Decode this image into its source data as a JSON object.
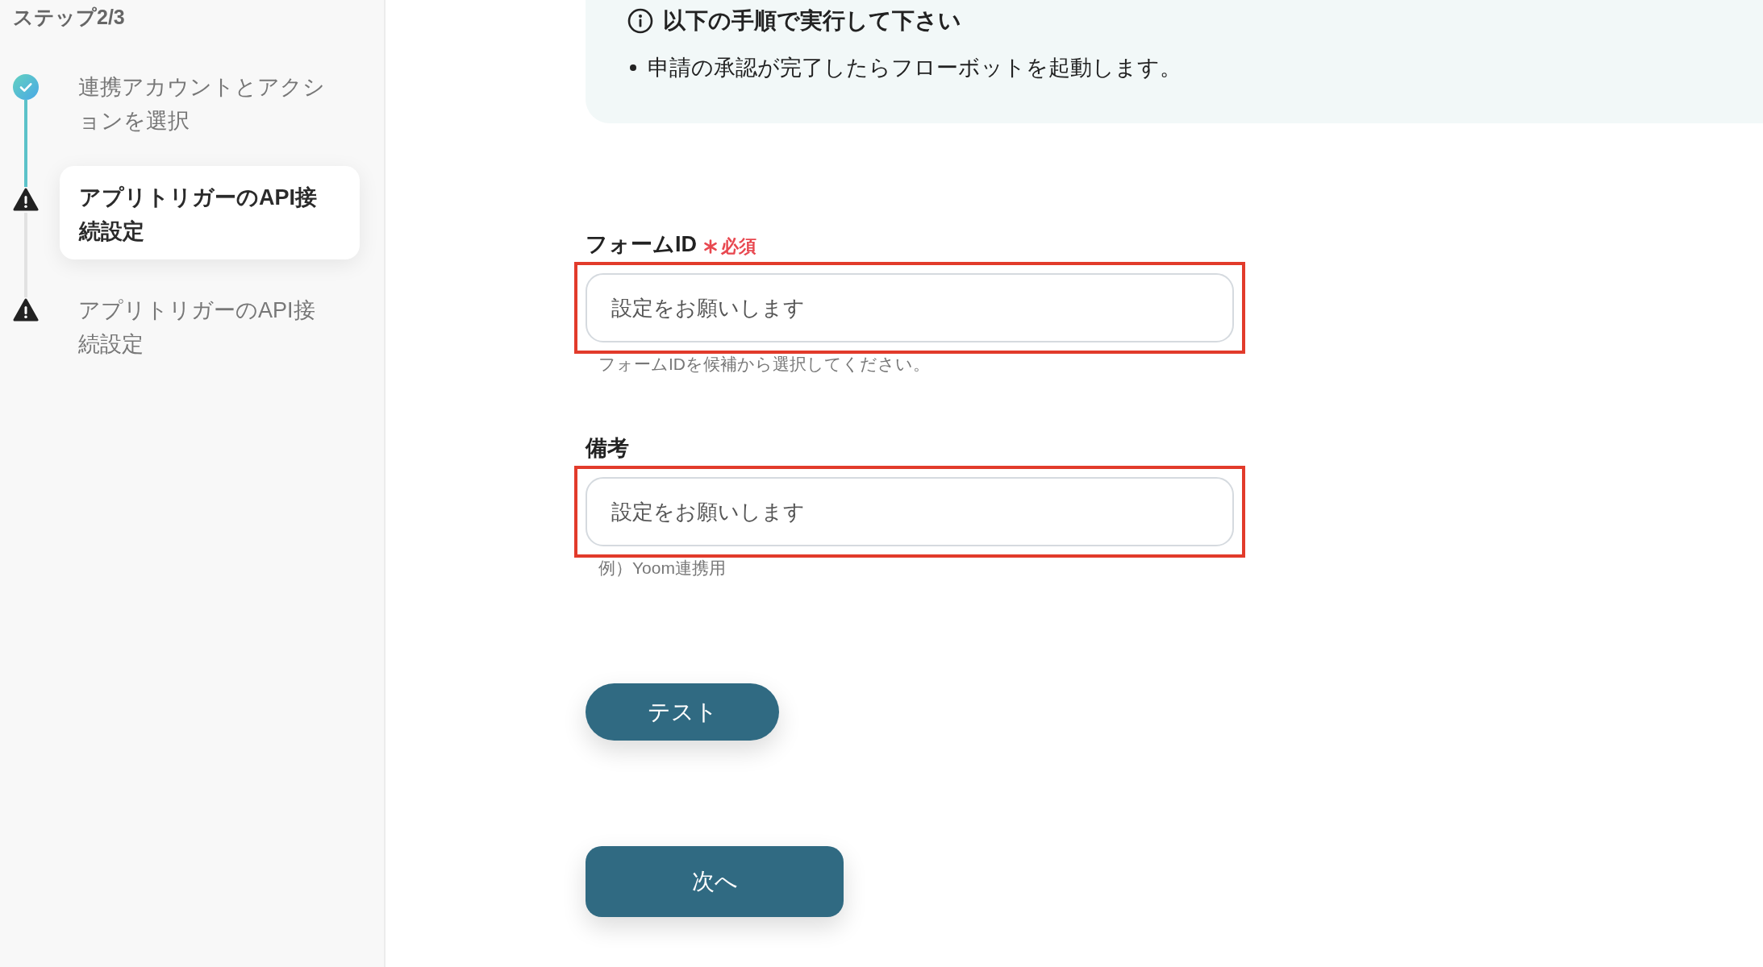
{
  "sidebar": {
    "title": "ステップ2/3",
    "steps": [
      {
        "label": "連携アカウントとアクションを選択",
        "completed": true,
        "selected": false
      },
      {
        "label": "アプリトリガーのAPI接続設定",
        "completed": false,
        "selected": true
      },
      {
        "label": "アプリトリガーのAPI接続設定",
        "completed": false,
        "selected": false
      }
    ]
  },
  "notice": {
    "title": "以下の手順で実行して下さい",
    "items": [
      "申請の承認が完了したらフローボットを起動します。"
    ]
  },
  "fields": [
    {
      "label": "フォームID",
      "required": true,
      "required_text": "必須",
      "placeholder": "設定をお願いします",
      "hint": "フォームIDを候補から選択してください。",
      "highlighted": true
    },
    {
      "label": "備考",
      "required": false,
      "placeholder": "設定をお願いします",
      "hint": "例）Yoom連携用",
      "highlighted": true
    }
  ],
  "buttons": [
    {
      "label": "テスト",
      "kind": "pill"
    },
    {
      "label": "次へ",
      "kind": "rounded"
    }
  ]
}
